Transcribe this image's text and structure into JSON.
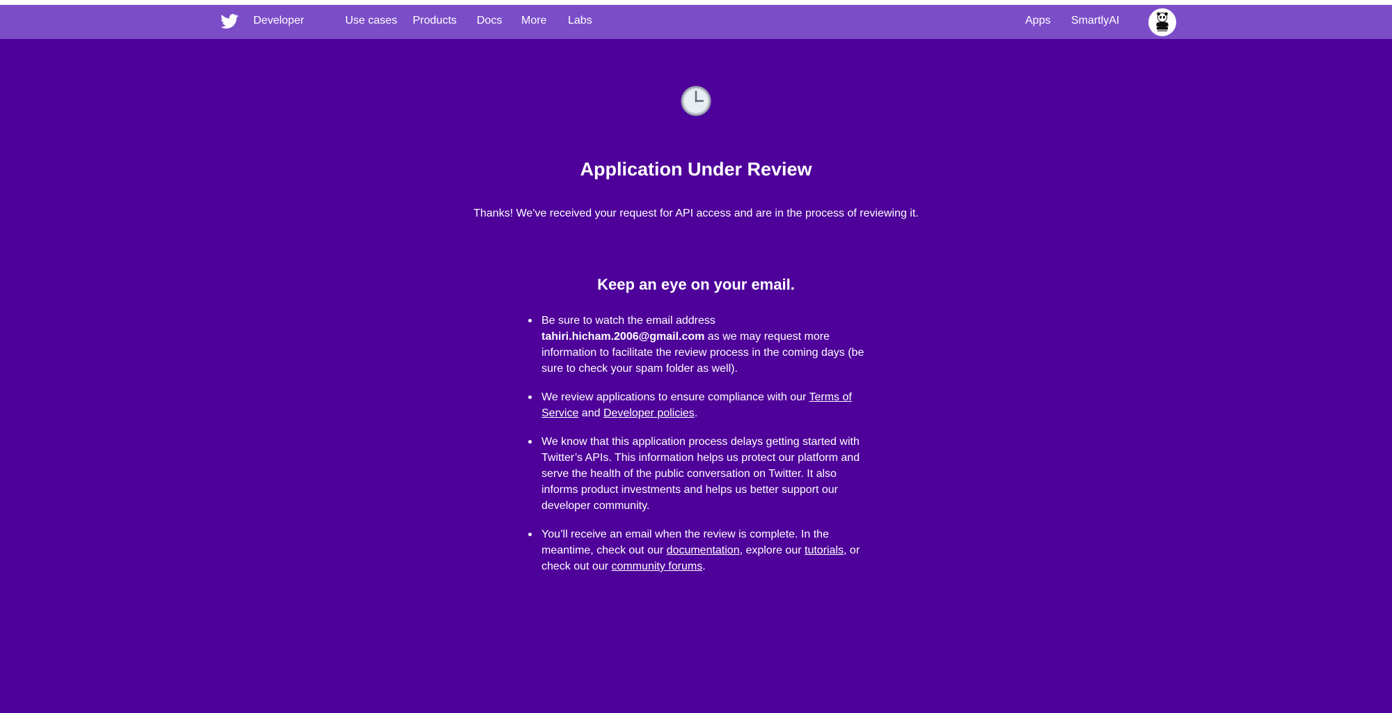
{
  "nav": {
    "brand": "Developer",
    "items": [
      "Use cases",
      "Products",
      "Docs",
      "More",
      "Labs"
    ],
    "right_items": [
      "Apps",
      "SmartlyAI"
    ]
  },
  "review": {
    "title": "Application Under Review",
    "intro": "Thanks! We've received your request for API access and are in the process of reviewing it.",
    "subtitle": "Keep an eye on your email."
  },
  "bullets": {
    "b1_pre": "Be sure to watch the email address ",
    "b1_email": "tahiri.hicham.2006@gmail.com",
    "b1_post": " as we may request more information to facilitate the review process in the coming days (be sure to check your spam folder as well).",
    "b2_pre": "We review applications to ensure compliance with our ",
    "b2_link1": "Terms of Service",
    "b2_mid": " and ",
    "b2_link2": "Developer policies",
    "b2_post": ".",
    "b3": "We know that this application process delays getting started with Twitter’s APIs. This information helps us protect our platform and serve the health of the public conversation on Twitter. It also informs product investments and helps us better support our developer community.",
    "b4_pre": "You’ll receive an email when the review is complete. In the meantime, check out our ",
    "b4_link1": "documentation",
    "b4_mid1": ", explore our ",
    "b4_link2": "tutorials",
    "b4_mid2": ", or check out our ",
    "b4_link3": "community forums",
    "b4_post": "."
  },
  "icons": {
    "logo": "twitter-bird-icon",
    "status": "clock-icon",
    "avatar": "wwf-panda-avatar"
  },
  "colors": {
    "background": "#4e0299",
    "navbar": "#7b4ec8",
    "text": "#ffffff"
  }
}
